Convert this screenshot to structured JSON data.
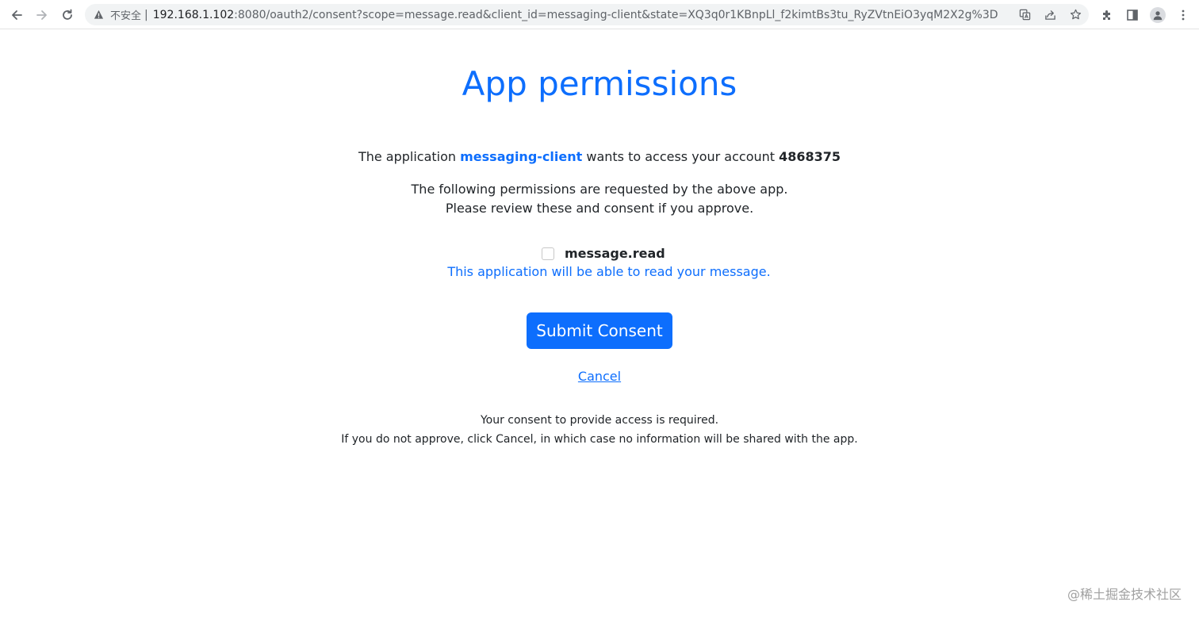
{
  "browser": {
    "insecure_label": "不安全",
    "separator": "|",
    "url_host": "192.168.1.102",
    "url_rest": ":8080/oauth2/consent?scope=message.read&client_id=messaging-client&state=XQ3q0r1KBnpLl_f2kimtBs3tu_RyZVtnEiO3yqM2X2g%3D"
  },
  "page": {
    "title": "App permissions",
    "access_prefix": "The application ",
    "client_id": "messaging-client",
    "access_middle": " wants to access your account ",
    "account": "4868375",
    "request_line1": "The following permissions are requested by the above app.",
    "request_line2": "Please review these and consent if you approve.",
    "scope": {
      "name": "message.read",
      "description": "This application will be able to read your message.",
      "checked": false
    },
    "submit_label": "Submit Consent",
    "cancel_label": "Cancel",
    "footer_line1": "Your consent to provide access is required.",
    "footer_line2": "If you do not approve, click Cancel, in which case no information will be shared with the app."
  },
  "watermark": "@稀土掘金技术社区",
  "colors": {
    "primary": "#0d6efd",
    "text": "#212529"
  }
}
